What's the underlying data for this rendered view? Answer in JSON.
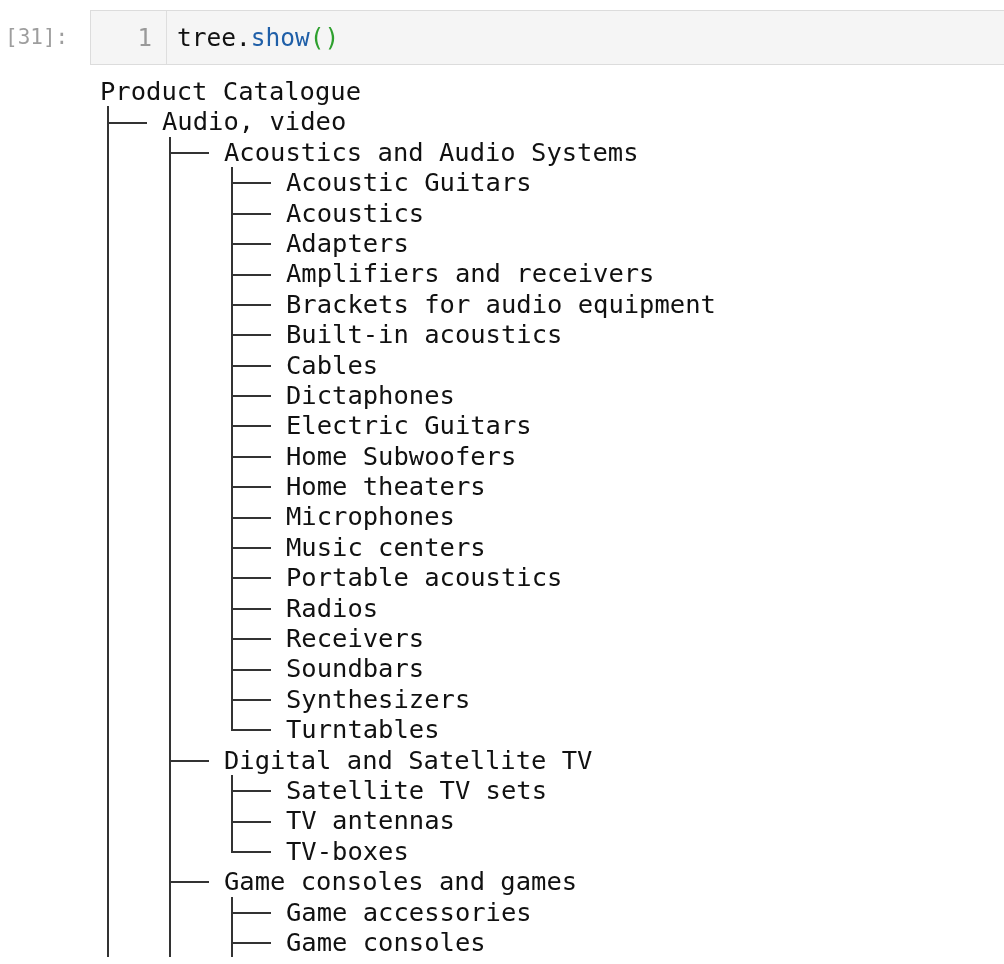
{
  "cell": {
    "prompt": "[31]:",
    "line_number": "1",
    "code": [
      {
        "kind": "plain",
        "text": "tree."
      },
      {
        "kind": "property",
        "text": "show"
      },
      {
        "kind": "bracket",
        "text": "()"
      }
    ]
  },
  "output": {
    "tree": {
      "label": "Product Catalogue",
      "children": [
        {
          "label": "Audio, video",
          "last": false,
          "children": [
            {
              "label": "Acoustics and Audio Systems",
              "last": false,
              "children": [
                {
                  "label": "Acoustic Guitars",
                  "last": false
                },
                {
                  "label": "Acoustics",
                  "last": false
                },
                {
                  "label": "Adapters",
                  "last": false
                },
                {
                  "label": "Amplifiers and receivers",
                  "last": false
                },
                {
                  "label": "Brackets for audio equipment",
                  "last": false
                },
                {
                  "label": "Built-in acoustics",
                  "last": false
                },
                {
                  "label": "Cables",
                  "last": false
                },
                {
                  "label": "Dictaphones",
                  "last": false
                },
                {
                  "label": "Electric Guitars",
                  "last": false
                },
                {
                  "label": "Home Subwoofers",
                  "last": false
                },
                {
                  "label": "Home theaters",
                  "last": false
                },
                {
                  "label": "Microphones",
                  "last": false
                },
                {
                  "label": "Music centers",
                  "last": false
                },
                {
                  "label": "Portable acoustics",
                  "last": false
                },
                {
                  "label": "Radios",
                  "last": false
                },
                {
                  "label": "Receivers",
                  "last": false
                },
                {
                  "label": "Soundbars",
                  "last": false
                },
                {
                  "label": "Synthesizers",
                  "last": false
                },
                {
                  "label": "Turntables",
                  "last": true
                }
              ]
            },
            {
              "label": "Digital and Satellite TV",
              "last": false,
              "children": [
                {
                  "label": "Satellite TV sets",
                  "last": false
                },
                {
                  "label": "TV antennas",
                  "last": false
                },
                {
                  "label": "TV-boxes",
                  "last": true
                }
              ]
            },
            {
              "label": "Game consoles and games",
              "last": false,
              "children": [
                {
                  "label": "Game accessories",
                  "last": false
                },
                {
                  "label": "Game consoles",
                  "last": false
                }
              ]
            }
          ]
        }
      ]
    }
  }
}
